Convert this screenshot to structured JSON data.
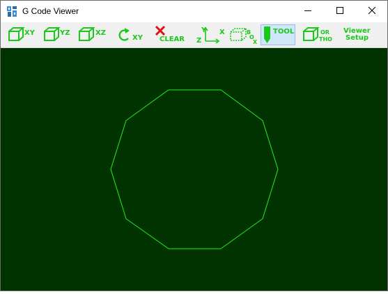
{
  "window": {
    "title": "G Code Viewer",
    "controls": {
      "minimize_icon": "minimize-icon",
      "maximize_icon": "maximize-icon",
      "close_icon": "close-icon"
    }
  },
  "toolbar": {
    "accent_color": "#19c819",
    "clear_icon_color": "#e01010",
    "buttons": [
      {
        "id": "view-xy",
        "label": "XY",
        "icon": "cube-icon"
      },
      {
        "id": "view-yz",
        "label": "YZ",
        "icon": "cube-icon"
      },
      {
        "id": "view-xz",
        "label": "XZ",
        "icon": "cube-icon"
      },
      {
        "id": "rotate-xy",
        "label": "XY",
        "icon": "rotate-icon"
      },
      {
        "id": "clear",
        "label": "CLEAR",
        "icon": "x-mark-icon"
      },
      {
        "id": "axes",
        "label_y": "Y",
        "label_x": "X",
        "label_z": "Z",
        "icon": "axes-icon"
      },
      {
        "id": "box",
        "label_b": "B",
        "label_o": "O",
        "label_x": "X",
        "icon": "box-icon"
      },
      {
        "id": "tool",
        "label": "TOOL",
        "icon": "tool-icon",
        "active": true
      },
      {
        "id": "ortho",
        "label_top": "OR",
        "label_bottom": "THO",
        "icon": "cube-icon"
      },
      {
        "id": "viewer-setup",
        "label_top": "Viewer",
        "label_bottom": "Setup"
      }
    ]
  },
  "canvas": {
    "background": "#003300",
    "path_color": "#22ee22",
    "shape": "decagon"
  }
}
